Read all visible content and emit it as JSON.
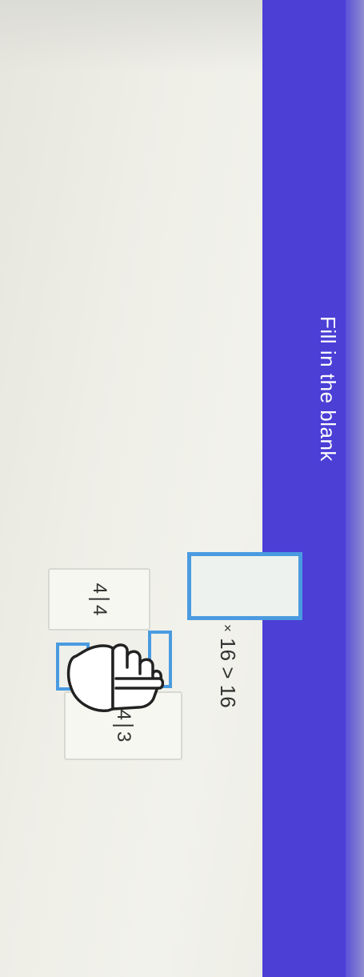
{
  "header": {
    "title": "Fill in the blank",
    "banner_color": "#4b3fd6"
  },
  "question": {
    "multiply_sign": "×",
    "factor": "16",
    "relation": ">",
    "result": "16"
  },
  "answer_box": {
    "border_color": "#4a9be0",
    "value": ""
  },
  "choices": [
    {
      "numerator": "4",
      "denominator": "4"
    },
    {
      "numerator": "3",
      "denominator": "4"
    }
  ],
  "cursor": {
    "icon": "hand-pointer-icon"
  }
}
